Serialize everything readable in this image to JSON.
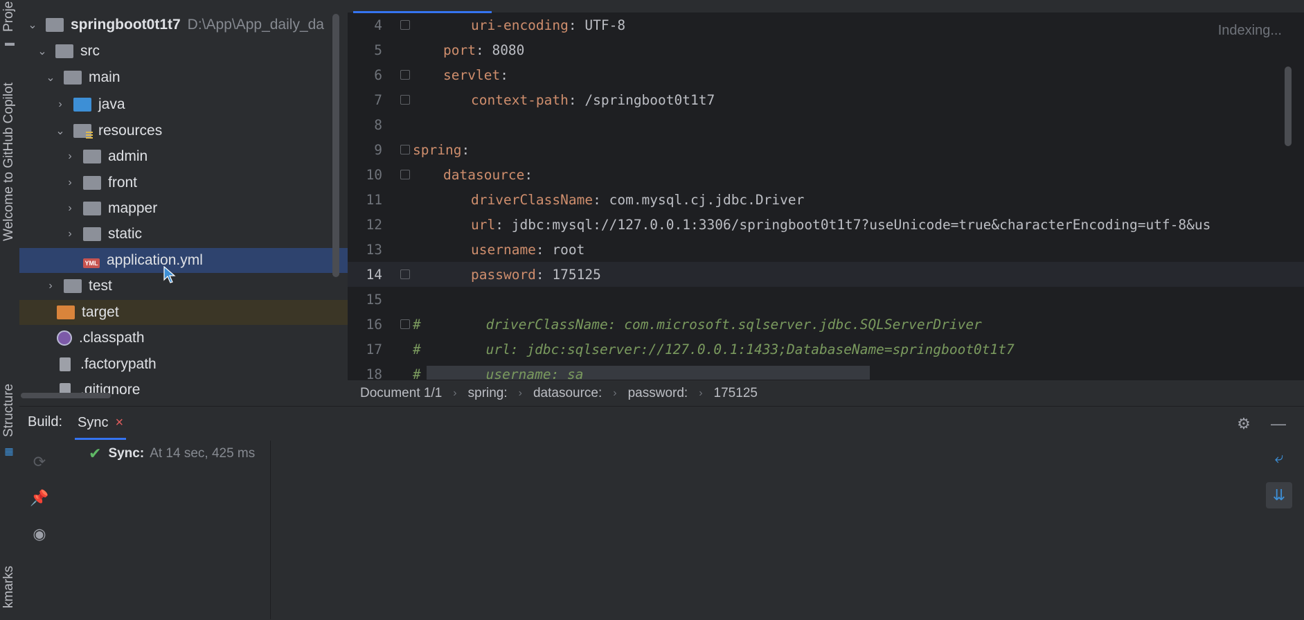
{
  "left_strip": {
    "project_label": "Proje",
    "copilot_label": "Welcome to GitHub Copilot",
    "structure_label": "Structure",
    "bookmarks_label": "kmarks"
  },
  "project_tree": {
    "root": {
      "name": "springboot0t1t7",
      "path": "D:\\App\\App_daily_da"
    },
    "items": [
      {
        "label": "src"
      },
      {
        "label": "main"
      },
      {
        "label": "java"
      },
      {
        "label": "resources"
      },
      {
        "label": "admin"
      },
      {
        "label": "front"
      },
      {
        "label": "mapper"
      },
      {
        "label": "static"
      },
      {
        "label": "application.yml"
      },
      {
        "label": "test"
      },
      {
        "label": "target"
      },
      {
        "label": ".classpath"
      },
      {
        "label": ".factorypath"
      },
      {
        "label": ".gitignore"
      }
    ]
  },
  "editor": {
    "status": "Indexing...",
    "file_type_badge": "YML",
    "lines": [
      {
        "num": "4",
        "key": "uri-encoding",
        "sep": ": ",
        "value": "UTF-8"
      },
      {
        "num": "5",
        "key": "port",
        "sep": ": ",
        "value": "8080"
      },
      {
        "num": "6",
        "key": "servlet",
        "sep": ":",
        "value": ""
      },
      {
        "num": "7",
        "key": "context-path",
        "sep": ": ",
        "value": "/springboot0t1t7"
      },
      {
        "num": "8",
        "key": "",
        "sep": "",
        "value": ""
      },
      {
        "num": "9",
        "key": "spring",
        "sep": ":",
        "value": ""
      },
      {
        "num": "10",
        "key": "datasource",
        "sep": ":",
        "value": ""
      },
      {
        "num": "11",
        "key": "driverClassName",
        "sep": ": ",
        "value": "com.mysql.cj.jdbc.Driver"
      },
      {
        "num": "12",
        "key": "url",
        "sep": ": ",
        "value": "jdbc:mysql://127.0.0.1:3306/springboot0t1t7?useUnicode=true&characterEncoding=utf-8&us"
      },
      {
        "num": "13",
        "key": "username",
        "sep": ": ",
        "value": "root"
      },
      {
        "num": "14",
        "key": "password",
        "sep": ": ",
        "value": "175125"
      },
      {
        "num": "15",
        "key": "",
        "sep": "",
        "value": ""
      },
      {
        "num": "16",
        "comment": "#        driverClassName: com.microsoft.sqlserver.jdbc.SQLServerDriver"
      },
      {
        "num": "17",
        "comment": "#        url: jdbc:sqlserver://127.0.0.1:1433;DatabaseName=springboot0t1t7"
      },
      {
        "num": "18",
        "comment": "#        username: sa"
      }
    ]
  },
  "breadcrumb": {
    "items": [
      "Document 1/1",
      "spring:",
      "datasource:",
      "password:",
      "175125"
    ]
  },
  "build_panel": {
    "label": "Build:",
    "tab": "Sync",
    "close_glyph": "×",
    "result_title": "Sync:",
    "result_detail": "At 14 sec, 425 ms"
  },
  "colors": {
    "accent": "#3574f0",
    "selection": "#2e436e",
    "key": "#cf8e6d",
    "comment": "#7a9a5e",
    "success": "#5fb865"
  }
}
